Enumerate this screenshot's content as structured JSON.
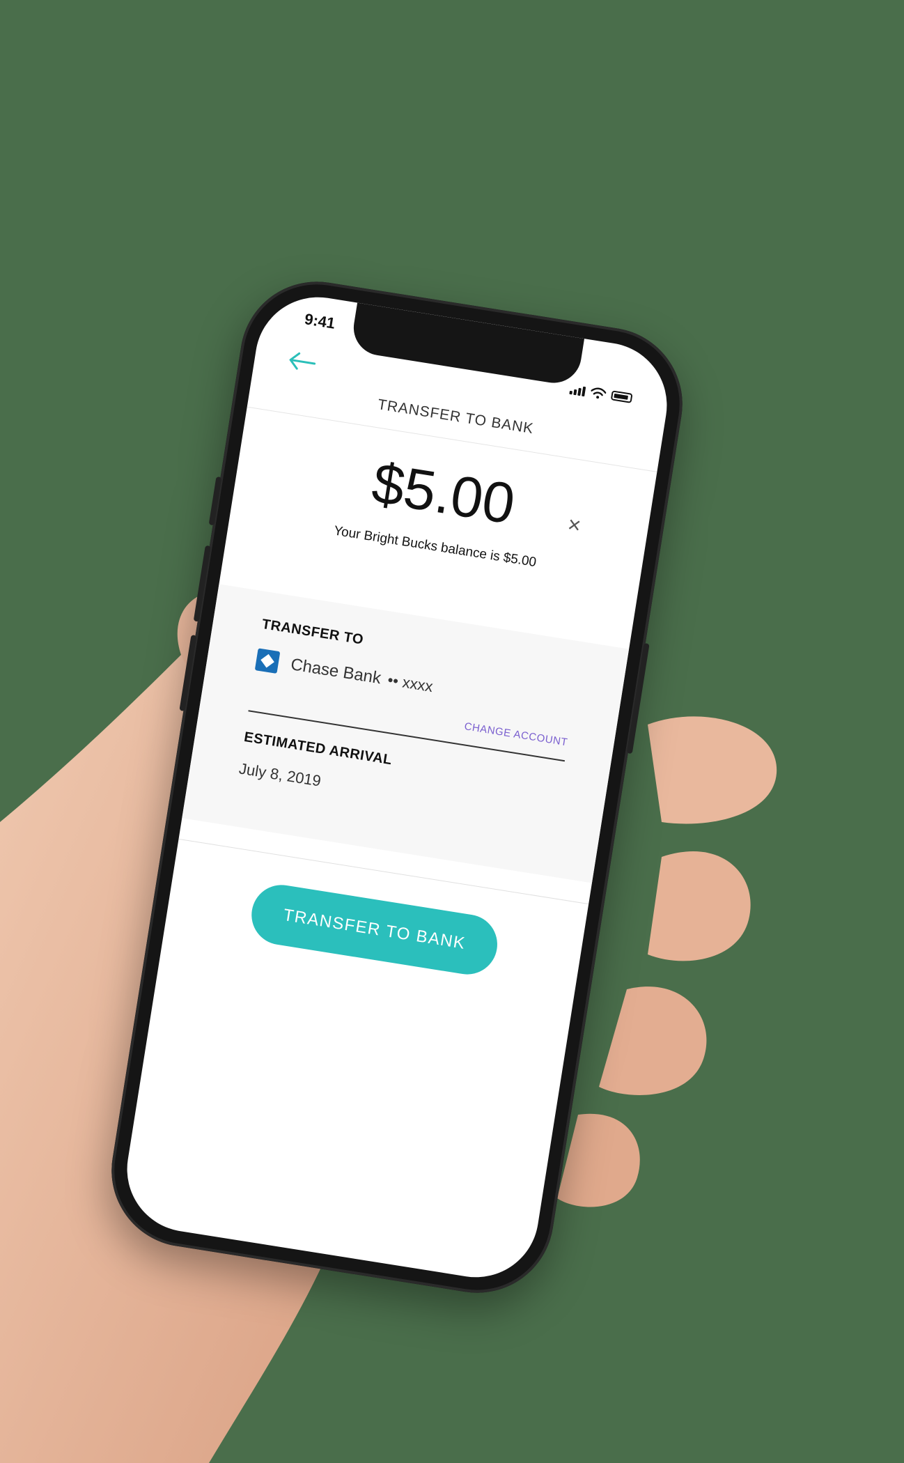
{
  "status_bar": {
    "time": "9:41"
  },
  "header": {
    "back_icon": "arrow-left-icon",
    "title": "TRANSFER TO BANK"
  },
  "amount": {
    "value": "$5.00",
    "clear_icon": "close-icon",
    "balance_text": "Your Bright Bucks balance is $5.00"
  },
  "transfer_to": {
    "label": "TRANSFER TO",
    "bank_icon": "chase-bank-logo-icon",
    "bank_name": "Chase Bank",
    "masked_account": "•• xxxx",
    "change_account_label": "CHANGE ACCOUNT"
  },
  "estimated_arrival": {
    "label": "ESTIMATED ARRIVAL",
    "date": "July 8, 2019"
  },
  "actions": {
    "transfer_button_label": "TRANSFER TO BANK"
  },
  "colors": {
    "accent": "#2bbfbc",
    "link": "#7a5fcf",
    "bank_logo": "#1a6fb7",
    "background": "#4a6e4b"
  }
}
